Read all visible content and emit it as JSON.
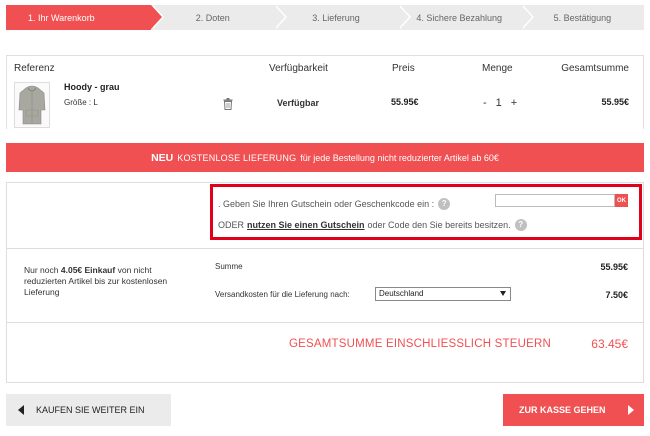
{
  "steps": [
    {
      "label": "1. Ihr Warenkorb",
      "active": true
    },
    {
      "label": "2. Doten",
      "active": false
    },
    {
      "label": "3. Lieferung",
      "active": false
    },
    {
      "label": "4. Sichere Bezahlung",
      "active": false
    },
    {
      "label": "5. Bestätigung",
      "active": false
    }
  ],
  "cart": {
    "headers": {
      "reference": "Referenz",
      "availability": "Verfügbarkeit",
      "price": "Preis",
      "quantity": "Menge",
      "total": "Gesamtsumme"
    },
    "item": {
      "name": "Hoody - grau",
      "size": "Größe : L",
      "availability": "Verfügbar",
      "price": "55.95€",
      "qty_minus": "-",
      "qty": "1",
      "qty_plus": "+",
      "total": "55.95€"
    }
  },
  "banner": {
    "neu": "NEU",
    "kostenlose": "KOSTENLOSE LIEFERUNG",
    "rest": "für jede Bestellung nicht reduzierter Artikel ab 60€"
  },
  "coupon": {
    "line1": ". Geben Sie Ihren Gutschein oder Geschenkcode ein :",
    "help": "?",
    "input_value": "",
    "ok": "OK",
    "oder": "ODER",
    "use_link": "nutzen Sie einen Gutschein",
    "line2_rest": "oder Code den Sie bereits besitzen."
  },
  "free_note": {
    "prefix": "Nur noch",
    "amount": "4.05€ Einkauf",
    "suffix": "von nicht reduzierten Artikel bis zur kostenlosen Lieferung"
  },
  "summary": {
    "sum_label": "Summe",
    "sum_value": "55.95€",
    "ship_label": "Versandkosten für die Lieferung nach:",
    "ship_country": "Deutschland",
    "ship_value": "7.50€",
    "grand_label": "GESAMTSUMME EINSCHLIESSLICH STEUERN",
    "grand_value": "63.45€"
  },
  "buttons": {
    "back": "KAUFEN SIE WEITER EIN",
    "checkout": "ZUR KASSE GEHEN"
  },
  "colors": {
    "accent": "#f05052",
    "highlight_border": "#e0001a",
    "step_bg": "#ebebeb"
  }
}
